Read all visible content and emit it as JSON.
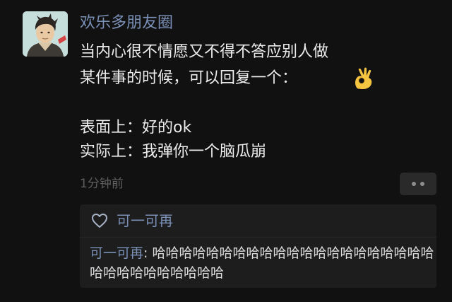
{
  "post": {
    "username": "欢乐多朋友圈",
    "avatar_icon": "user-avatar-illustration",
    "lines": [
      "当内心很不情愿又不得不答应别人做",
      "某件事的时候，可以回复一个：",
      "表面上：好的ok",
      "实际上：我弹你一个脑瓜崩"
    ],
    "emoji_icon": "ok-hand-emoji",
    "timestamp": "1分钟前",
    "more_icon": "more-dots-icon"
  },
  "likes": {
    "icon": "heart-outline-icon",
    "names": "可一可再"
  },
  "comments": [
    {
      "author": "可一可再",
      "separator": ": ",
      "text": "哈哈哈哈哈哈哈哈哈哈哈哈哈哈哈哈哈哈哈哈哈哈哈哈哈哈哈哈哈哈哈"
    }
  ],
  "colors": {
    "background": "#111111",
    "name_link": "#7b90b6",
    "text": "#ececec",
    "meta": "#5f5f5f",
    "panel": "#1d1d1d"
  }
}
